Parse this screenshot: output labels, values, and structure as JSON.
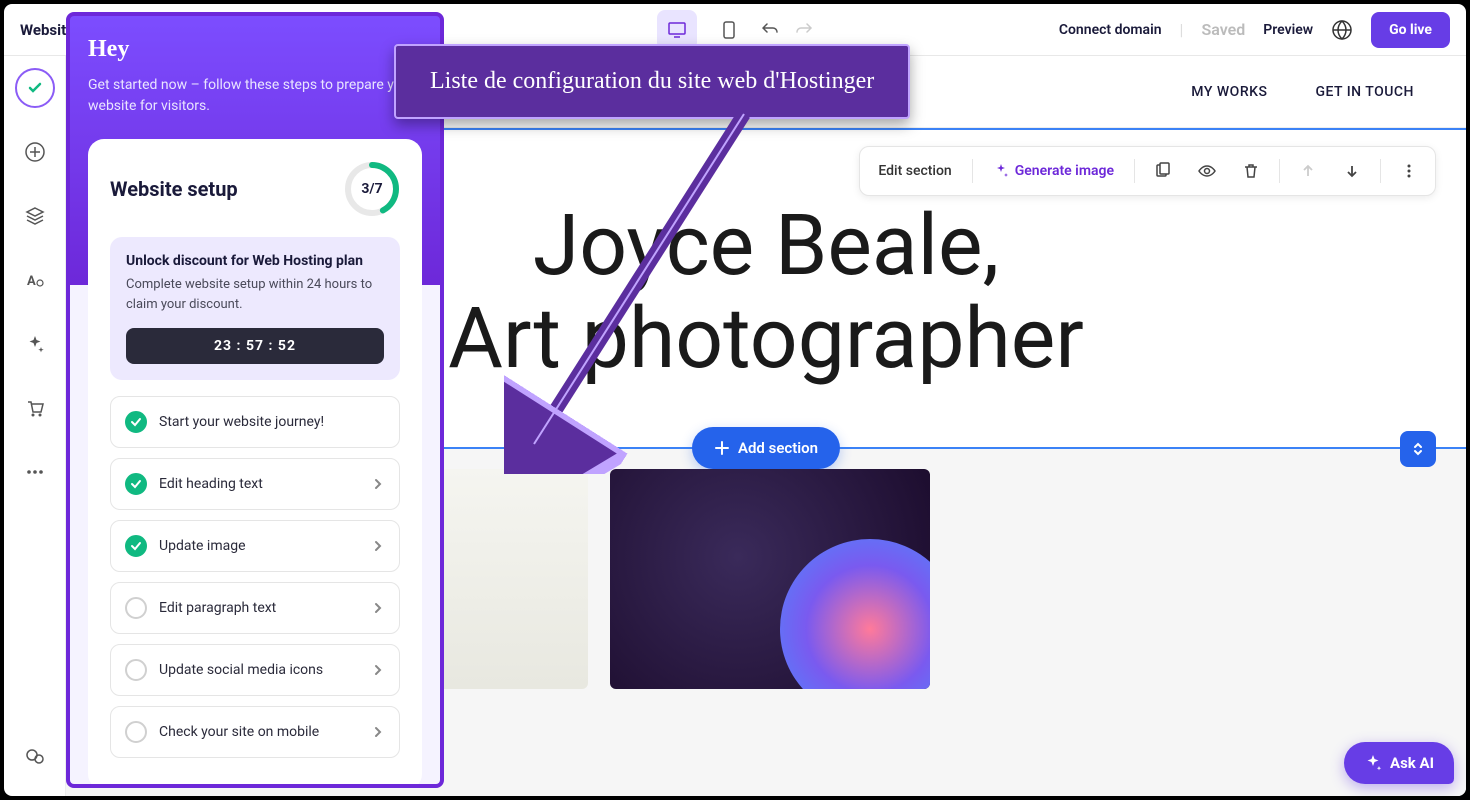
{
  "topbar": {
    "title": "Website Builder",
    "connect_domain": "Connect domain",
    "saved": "Saved",
    "preview": "Preview",
    "go_live": "Go live"
  },
  "site_nav": {
    "my_works": "MY WORKS",
    "get_in_touch": "GET IN TOUCH"
  },
  "hero": {
    "line1": "Joyce Beale,",
    "line2": "Art photographer"
  },
  "toolbar": {
    "edit_section": "Edit section",
    "generate_image": "Generate image"
  },
  "add_section": "Add section",
  "panel": {
    "hey": "Hey",
    "subtitle": "Get started now – follow these steps to prepare your website for visitors.",
    "setup_title": "Website setup",
    "progress": "3/7",
    "discount_title": "Unlock discount for Web Hosting plan",
    "discount_sub": "Complete website setup within 24 hours to claim your discount.",
    "timer": "23 : 57 : 52",
    "tasks": [
      {
        "label": "Start your website journey!",
        "done": true,
        "chevron": false
      },
      {
        "label": "Edit heading text",
        "done": true,
        "chevron": true
      },
      {
        "label": "Update image",
        "done": true,
        "chevron": true
      },
      {
        "label": "Edit paragraph text",
        "done": false,
        "chevron": true
      },
      {
        "label": "Update social media icons",
        "done": false,
        "chevron": true
      },
      {
        "label": "Check your site on mobile",
        "done": false,
        "chevron": true
      }
    ]
  },
  "callout": "Liste de configuration du site web d'Hostinger",
  "ask_ai": "Ask AI"
}
